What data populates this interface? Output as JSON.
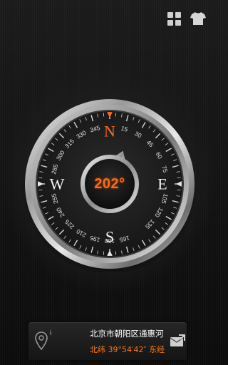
{
  "toolbar": {
    "grid_icon": "grid-icon",
    "skin_icon": "tshirt-icon"
  },
  "compass": {
    "heading_deg": 202,
    "heading_text": "202°",
    "cardinals": [
      "N",
      "E",
      "S",
      "W"
    ],
    "degree_labels": [
      "15",
      "30",
      "45",
      "60",
      "75",
      "105",
      "120",
      "135",
      "165",
      "180",
      "195",
      "210",
      "225",
      "240",
      "255",
      "285",
      "300",
      "315",
      "330",
      "345"
    ],
    "accent_color": "#ff6b16"
  },
  "info": {
    "location_icon": "map-pin-icon",
    "info_letter": "i",
    "address": "北京市朝阳区通惠河",
    "coordinates": "北纬 39°54′42″   东经",
    "share_icon": "envelope-share-icon"
  }
}
